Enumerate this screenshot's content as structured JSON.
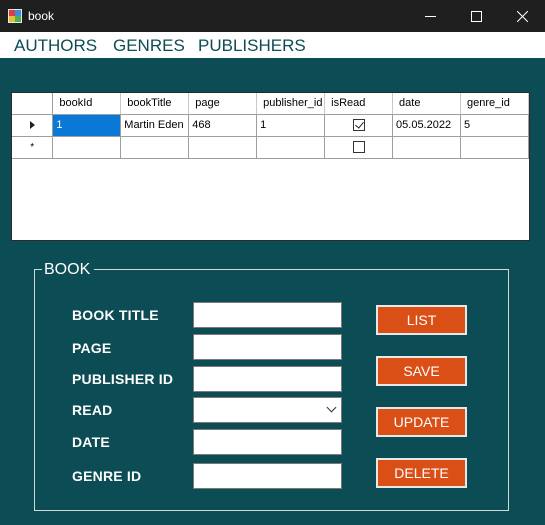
{
  "window": {
    "title": "book",
    "minimize_icon": "minimize-icon",
    "maximize_icon": "maximize-icon",
    "close_icon": "close-icon"
  },
  "menu": [
    "AUTHORS",
    "GENRES",
    "PUBLISHERS"
  ],
  "grid": {
    "columns": [
      "bookId",
      "bookTitle",
      "page",
      "publisher_id",
      "isRead",
      "date",
      "genre_id"
    ],
    "rows": [
      {
        "bookId": "1",
        "bookTitle": "Martin Eden",
        "page": "468",
        "publisher_id": "1",
        "isRead": true,
        "date": "05.05.2022",
        "genre_id": "5"
      }
    ],
    "new_row_marker": "*"
  },
  "form": {
    "title": "BOOK",
    "labels": {
      "book_title": "BOOK TITLE",
      "page": "PAGE",
      "publisher_id": "PUBLISHER ID",
      "read": "READ",
      "date": "DATE",
      "genre_id": "GENRE ID"
    },
    "values": {
      "book_title": "",
      "page": "",
      "publisher_id": "",
      "read": "",
      "date": "",
      "genre_id": ""
    },
    "buttons": {
      "list": "LIST",
      "save": "SAVE",
      "update": "UPDATE",
      "delete": "DELETE"
    }
  },
  "colors": {
    "background": "#0c4c54",
    "button": "#d94f16",
    "selection": "#0a78d7"
  }
}
